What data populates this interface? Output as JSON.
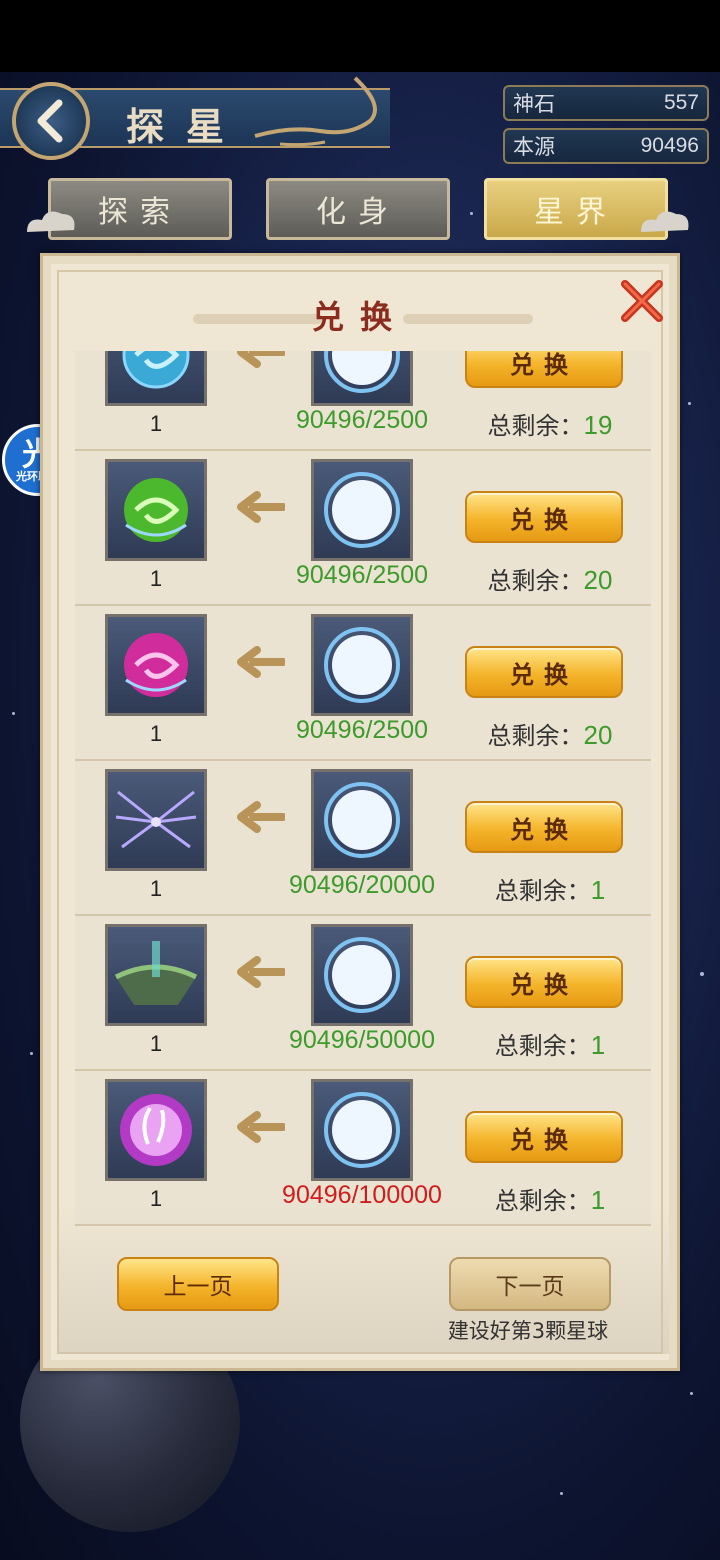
{
  "header": {
    "title": "探星",
    "currencies": [
      {
        "label": "神石",
        "value": "557"
      },
      {
        "label": "本源",
        "value": "90496"
      }
    ]
  },
  "tabs": [
    {
      "label": "探索",
      "active": false
    },
    {
      "label": "化身",
      "active": false
    },
    {
      "label": "星界",
      "active": true
    }
  ],
  "helper_badge": {
    "glyph": "光",
    "label": "光环助手"
  },
  "panel": {
    "title": "兑换",
    "rows": [
      {
        "reward_icon": "blue-orb-icon",
        "reward_count": "1",
        "cost": "90496/2500",
        "cost_color": "#3d9a2c",
        "button": "兑换",
        "remain_label": "总剩余：",
        "remain_value": "19"
      },
      {
        "reward_icon": "green-orb-icon",
        "reward_count": "1",
        "cost": "90496/2500",
        "cost_color": "#3d9a2c",
        "button": "兑换",
        "remain_label": "总剩余：",
        "remain_value": "20"
      },
      {
        "reward_icon": "pink-orb-icon",
        "reward_count": "1",
        "cost": "90496/2500",
        "cost_color": "#3d9a2c",
        "button": "兑换",
        "remain_label": "总剩余：",
        "remain_value": "20"
      },
      {
        "reward_icon": "lightning-wings-icon",
        "reward_count": "1",
        "cost": "90496/20000",
        "cost_color": "#3d9a2c",
        "button": "兑换",
        "remain_label": "总剩余：",
        "remain_value": "1"
      },
      {
        "reward_icon": "floating-island-icon",
        "reward_count": "1",
        "cost": "90496/50000",
        "cost_color": "#3d9a2c",
        "button": "兑换",
        "remain_label": "总剩余：",
        "remain_value": "1"
      },
      {
        "reward_icon": "rabbit-orb-icon",
        "reward_count": "1",
        "cost": "90496/100000",
        "cost_color": "#d21c1c",
        "button": "兑换",
        "remain_label": "总剩余：",
        "remain_value": "1"
      }
    ],
    "prev_label": "上一页",
    "next_label": "下一页",
    "next_hint": "建设好第3颗星球"
  }
}
